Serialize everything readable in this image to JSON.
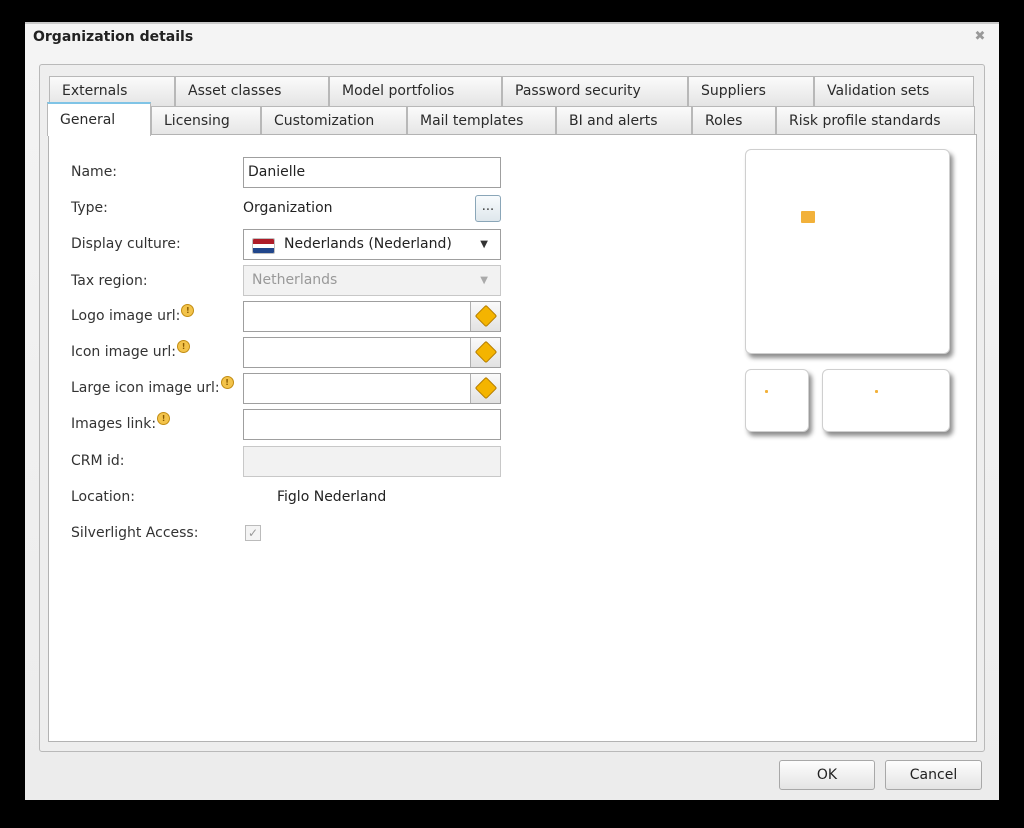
{
  "dialog": {
    "title": "Organization details",
    "close_icon": "close-icon"
  },
  "tabs_top": [
    {
      "label": "Externals"
    },
    {
      "label": "Asset classes"
    },
    {
      "label": "Model portfolios"
    },
    {
      "label": "Password security"
    },
    {
      "label": "Suppliers"
    },
    {
      "label": "Validation sets"
    }
  ],
  "tabs_bottom": [
    {
      "label": "General",
      "active": true
    },
    {
      "label": "Licensing"
    },
    {
      "label": "Customization"
    },
    {
      "label": "Mail templates"
    },
    {
      "label": "BI and alerts"
    },
    {
      "label": "Roles"
    },
    {
      "label": "Risk profile standards"
    }
  ],
  "form": {
    "name_label": "Name:",
    "name_value": "Danielle",
    "type_label": "Type:",
    "type_value": "Organization",
    "type_button": "...",
    "display_culture_label": "Display culture:",
    "display_culture_value": "Nederlands (Nederland)",
    "tax_region_label": "Tax region:",
    "tax_region_value": "Netherlands",
    "logo_label": "Logo image url:",
    "icon_label": "Icon image url:",
    "large_icon_label": "Large icon image url:",
    "images_link_label": "Images link:",
    "crm_label": "CRM id:",
    "location_label": "Location:",
    "location_value": "Figlo Nederland",
    "silverlight_label": "Silverlight Access:",
    "silverlight_checked": true,
    "info_marker": "!"
  },
  "flag_colors": [
    "#ae1c28",
    "#ffffff",
    "#21468b"
  ],
  "accent_color": "#f2b13a",
  "buttons": {
    "ok": "OK",
    "cancel": "Cancel"
  }
}
